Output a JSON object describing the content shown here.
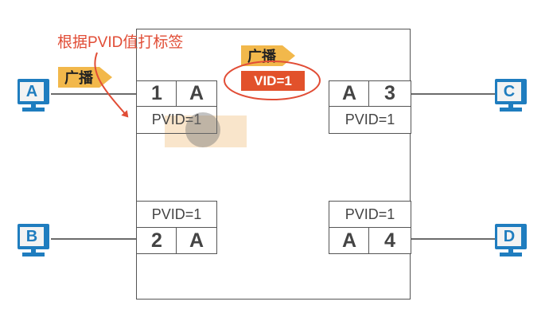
{
  "annotation": "根据PVID值打标签",
  "broadcast_label": "广播",
  "tag_label": "VID=1",
  "hosts": {
    "a": "A",
    "b": "B",
    "c": "C",
    "d": "D"
  },
  "ports": {
    "p1": {
      "num": "1",
      "vlan": "A",
      "pvid": "PVID=1"
    },
    "p2": {
      "num": "2",
      "vlan": "A",
      "pvid": "PVID=1"
    },
    "p3": {
      "num": "3",
      "vlan": "A",
      "pvid": "PVID=1"
    },
    "p4": {
      "num": "4",
      "vlan": "A",
      "pvid": "PVID=1"
    }
  },
  "colors": {
    "accent_red": "#e14d36",
    "broadcast_orange": "#f2b84b",
    "pc_blue": "#1f7dbf"
  }
}
